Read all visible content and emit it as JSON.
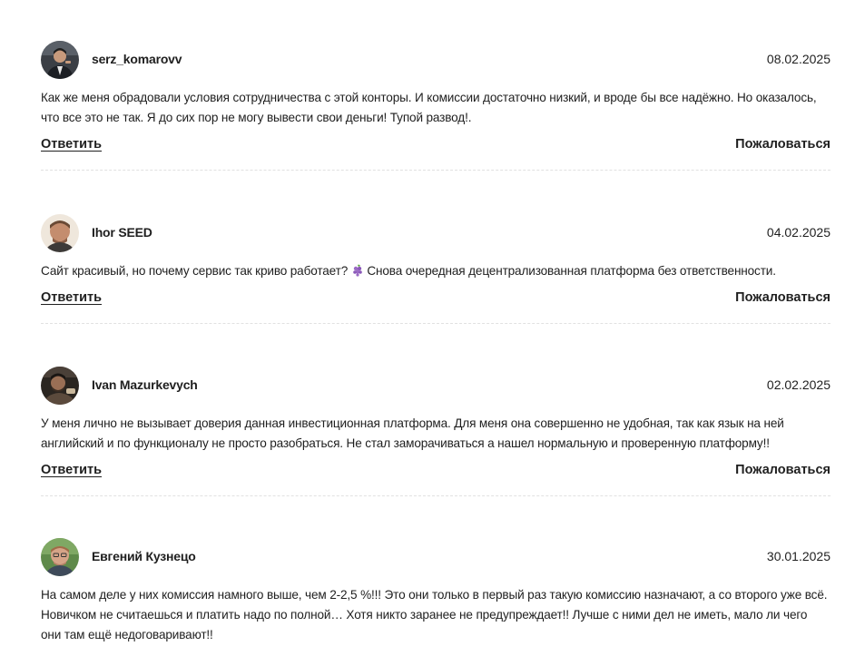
{
  "comments": [
    {
      "author": "serz_komarovv",
      "date": "08.02.2025",
      "avatar_icon": "user-photo-icon",
      "text": "Как же меня обрадовали условия сотрудничества с этой конторы. И комиссии достаточно низкий, и вроде бы все надёжно. Но оказалось, что все это не так. Я до сих пор не могу вывести свои деньги! Тупой развод!.",
      "reply_label": "Ответить",
      "report_label": "Пожаловаться"
    },
    {
      "author": "Ihor SEED",
      "date": "04.02.2025",
      "avatar_icon": "user-photo-icon",
      "text_before_emoji": "Сайт красивый, но почему сервис так криво работает? ",
      "emoji_icon": "grapes-emoji-icon",
      "text_after_emoji": " Снова очередная децентрализованная платформа без ответственности.",
      "reply_label": "Ответить",
      "report_label": "Пожаловаться"
    },
    {
      "author": "Ivan Mazurkevych",
      "date": "02.02.2025",
      "avatar_icon": "user-photo-icon",
      "text": "У меня лично не вызывает доверия данная инвестиционная платформа. Для меня она совершенно не удобная, так как язык на ней английский и по функционалу не просто разобраться. Не стал заморачиваться а нашел нормальную и проверенную платформу!!",
      "reply_label": "Ответить",
      "report_label": "Пожаловаться"
    },
    {
      "author": "Евгений Кузнецо",
      "date": "30.01.2025",
      "avatar_icon": "user-photo-icon",
      "text": "На самом деле у них комиссия намного выше, чем 2-2,5 %!!! Это они только в первый раз такую комиссию назначают, а со второго уже всё. Новичком не считаешься и платить надо по полной… Хотя никто заранее не предупреждает!! Лучше с ними дел не иметь, мало ли чего они там ещё недоговаривают!!"
    }
  ]
}
